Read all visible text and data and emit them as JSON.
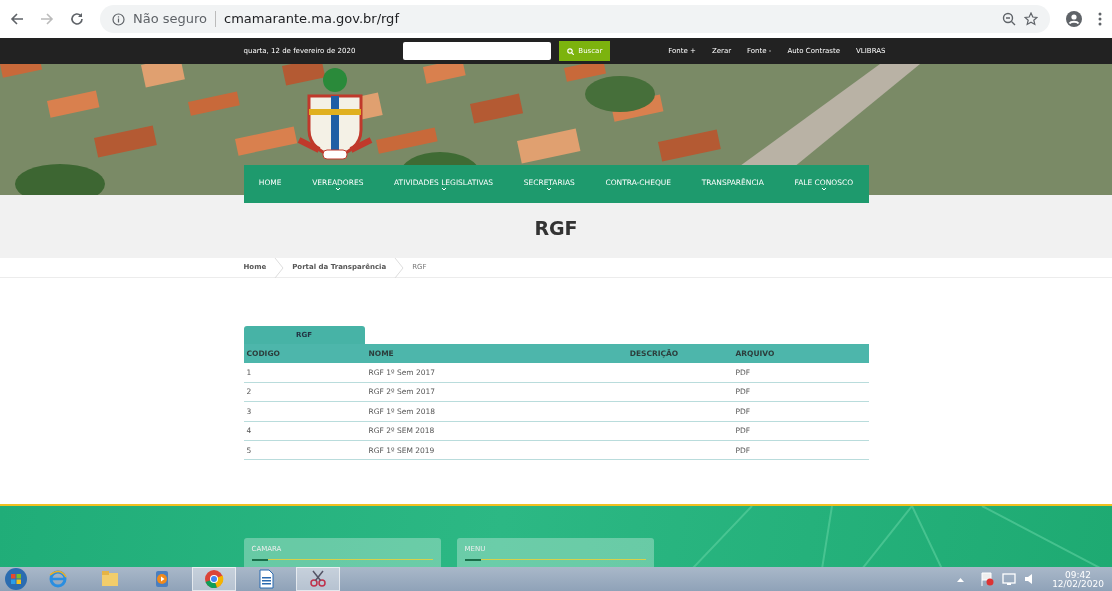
{
  "browser": {
    "security_label": "Não seguro",
    "url": "cmamarante.ma.gov.br/rgf"
  },
  "topbar": {
    "date": "quarta, 12 de fevereiro de 2020",
    "search_button": "Buscar",
    "links": [
      "Fonte +",
      "Zerar",
      "Fonte -",
      "Auto Contraste",
      "VLIBRAS"
    ]
  },
  "nav": [
    {
      "label": "HOME",
      "dropdown": false
    },
    {
      "label": "VEREADORES",
      "dropdown": true
    },
    {
      "label": "ATIVIDADES LEGISLATIVAS",
      "dropdown": true
    },
    {
      "label": "SECRETARIAS",
      "dropdown": true
    },
    {
      "label": "CONTRA-CHEQUE",
      "dropdown": false
    },
    {
      "label": "TRANSPARÊNCIA",
      "dropdown": false
    },
    {
      "label": "FALE CONOSCO",
      "dropdown": true
    }
  ],
  "page_title": "RGF",
  "breadcrumb": [
    {
      "label": "Home",
      "current": false
    },
    {
      "label": "Portal da Transparência",
      "current": false
    },
    {
      "label": "RGF",
      "current": true
    }
  ],
  "tabs": [
    {
      "label": "RGF",
      "selected": true
    }
  ],
  "table": {
    "columns": [
      "CODIGO",
      "NOME",
      "DESCRIÇÃO",
      "ARQUIVO"
    ],
    "rows": [
      [
        "1",
        "RGF 1º Sem 2017",
        "",
        "PDF"
      ],
      [
        "2",
        "RGF 2º Sem 2017",
        "",
        "PDF"
      ],
      [
        "3",
        "RGF 1º Sem 2018",
        "",
        "PDF"
      ],
      [
        "4",
        "RGF 2º SEM 2018",
        "",
        "PDF"
      ],
      [
        "5",
        "RGF 1º SEM 2019",
        "",
        "PDF"
      ]
    ]
  },
  "footer": {
    "cards": [
      {
        "title": "CAMARA"
      },
      {
        "title": "MENU"
      }
    ]
  },
  "taskbar": {
    "apps": [
      {
        "kind": "browser-e",
        "active": false
      },
      {
        "kind": "folder",
        "active": false
      },
      {
        "kind": "player",
        "active": false
      },
      {
        "kind": "chrome",
        "active": true
      },
      {
        "kind": "document",
        "active": false
      },
      {
        "kind": "scissors",
        "active": true
      }
    ],
    "time": "09:42",
    "date": "12/02/2020"
  }
}
